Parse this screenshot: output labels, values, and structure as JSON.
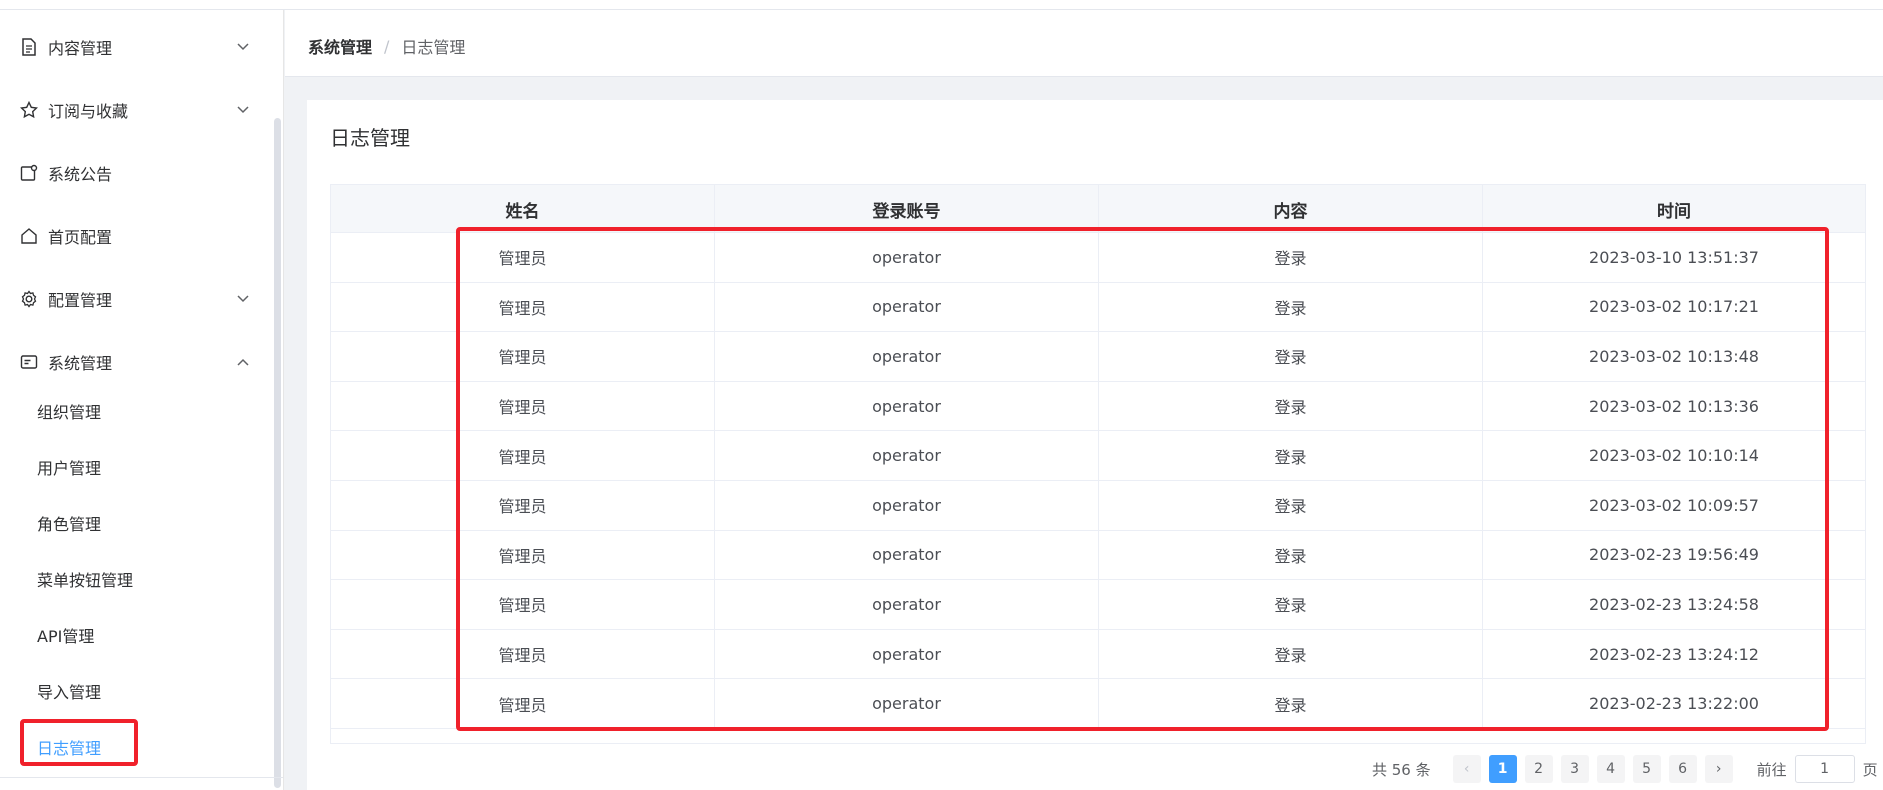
{
  "sidebar": {
    "items": [
      {
        "label": "内容管理",
        "icon": "document-icon",
        "expand": "chevron-down"
      },
      {
        "label": "订阅与收藏",
        "icon": "star-icon",
        "expand": "chevron-down"
      },
      {
        "label": "系统公告",
        "icon": "notice-icon"
      },
      {
        "label": "首页配置",
        "icon": "home-icon"
      },
      {
        "label": "配置管理",
        "icon": "gear-icon",
        "expand": "chevron-down"
      },
      {
        "label": "系统管理",
        "icon": "card-icon",
        "expand": "chevron-up"
      }
    ],
    "sub_items": [
      "组织管理",
      "用户管理",
      "角色管理",
      "菜单按钮管理",
      "API管理",
      "导入管理",
      "日志管理"
    ],
    "active_sub": "日志管理"
  },
  "breadcrumb": {
    "first": "系统管理",
    "separator": "/",
    "current": "日志管理"
  },
  "card": {
    "title": "日志管理"
  },
  "table": {
    "headers": [
      "姓名",
      "登录账号",
      "内容",
      "时间"
    ],
    "rows": [
      [
        "管理员",
        "operator",
        "登录",
        "2023-03-10 13:51:37"
      ],
      [
        "管理员",
        "operator",
        "登录",
        "2023-03-02 10:17:21"
      ],
      [
        "管理员",
        "operator",
        "登录",
        "2023-03-02 10:13:48"
      ],
      [
        "管理员",
        "operator",
        "登录",
        "2023-03-02 10:13:36"
      ],
      [
        "管理员",
        "operator",
        "登录",
        "2023-03-02 10:10:14"
      ],
      [
        "管理员",
        "operator",
        "登录",
        "2023-03-02 10:09:57"
      ],
      [
        "管理员",
        "operator",
        "登录",
        "2023-02-23 19:56:49"
      ],
      [
        "管理员",
        "operator",
        "登录",
        "2023-02-23 13:24:58"
      ],
      [
        "管理员",
        "operator",
        "登录",
        "2023-02-23 13:24:12"
      ],
      [
        "管理员",
        "operator",
        "登录",
        "2023-02-23 13:22:00"
      ]
    ]
  },
  "pagination": {
    "total_text": "共 56 条",
    "prev": "‹",
    "next": "›",
    "pages": [
      "1",
      "2",
      "3",
      "4",
      "5",
      "6"
    ],
    "current_page": "1",
    "goto_label": "前往",
    "goto_value": "1",
    "page_suffix": "页"
  },
  "colors": {
    "accent": "#409eff",
    "highlight": "#f0212b"
  }
}
